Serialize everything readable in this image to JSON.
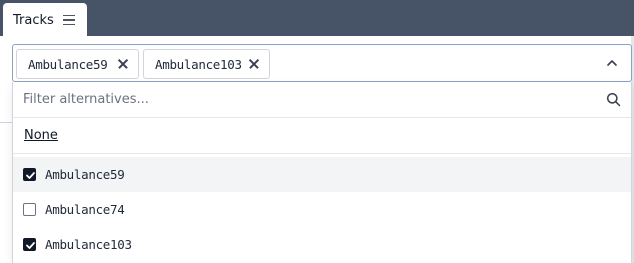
{
  "panel": {
    "tab_label": "Tracks",
    "tab_menu_icon": "hamburger-icon"
  },
  "select": {
    "selected_chips": [
      {
        "label": "Ambulance59"
      },
      {
        "label": "Ambulance103"
      }
    ],
    "chevron_icon": "chevron-up-icon",
    "remove_icon": "close-icon"
  },
  "dropdown": {
    "filter_placeholder": "Filter alternatives...",
    "filter_value": "",
    "search_icon": "search-icon",
    "none_label": "None",
    "options": [
      {
        "label": "Ambulance59",
        "checked": true,
        "highlighted": true
      },
      {
        "label": "Ambulance74",
        "checked": false,
        "highlighted": false
      },
      {
        "label": "Ambulance103",
        "checked": true,
        "highlighted": false
      }
    ]
  },
  "colors": {
    "topbar": "#475467",
    "checkbox_checked": "#111827",
    "select_border": "#8aa3c4"
  }
}
